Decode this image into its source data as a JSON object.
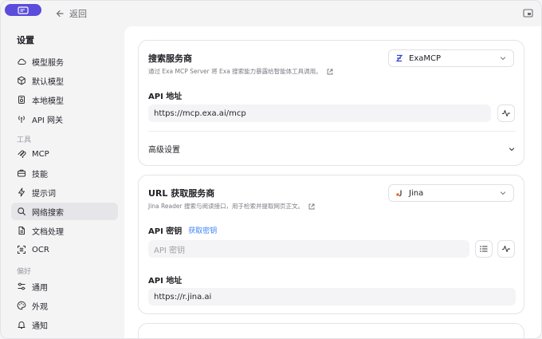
{
  "titlebar": {
    "back_label": "返回"
  },
  "sidebar": {
    "heading": "设置",
    "groups": {
      "tools": "工具",
      "prefs": "偏好"
    },
    "items": [
      {
        "label": "模型服务",
        "icon": "cloud-icon"
      },
      {
        "label": "默认模型",
        "icon": "cube-icon"
      },
      {
        "label": "本地模型",
        "icon": "local-icon"
      },
      {
        "label": "API 网关",
        "icon": "antenna-icon"
      },
      {
        "label": "MCP",
        "icon": "mcp-icon"
      },
      {
        "label": "技能",
        "icon": "briefcase-icon"
      },
      {
        "label": "提示词",
        "icon": "spark-icon"
      },
      {
        "label": "网络搜索",
        "icon": "search-icon"
      },
      {
        "label": "文档处理",
        "icon": "document-icon"
      },
      {
        "label": "OCR",
        "icon": "scan-icon"
      },
      {
        "label": "通用",
        "icon": "sliders-icon"
      },
      {
        "label": "外观",
        "icon": "palette-icon"
      },
      {
        "label": "通知",
        "icon": "bell-icon"
      }
    ]
  },
  "search_card": {
    "title": "搜索服务商",
    "description": "通过 Exa MCP Server 将 Exa 搜索能力暴露给智能体工具调用。",
    "provider": "ExaMCP",
    "api_url_label": "API 地址",
    "api_url_value": "https://mcp.exa.ai/mcp",
    "advanced_label": "高级设置"
  },
  "fetch_card": {
    "title": "URL 获取服务商",
    "description": "Jina Reader 搜索与阅读接口，用于检索并提取网页正文。",
    "provider": "Jina",
    "api_key_label": "API 密钥",
    "get_key_link": "获取密钥",
    "api_key_placeholder": "API 密钥",
    "api_url_label": "API 地址",
    "api_url_value": "https://r.jina.ai"
  },
  "colors": {
    "accent": "#5b4cdb",
    "link": "#3b82f6"
  }
}
